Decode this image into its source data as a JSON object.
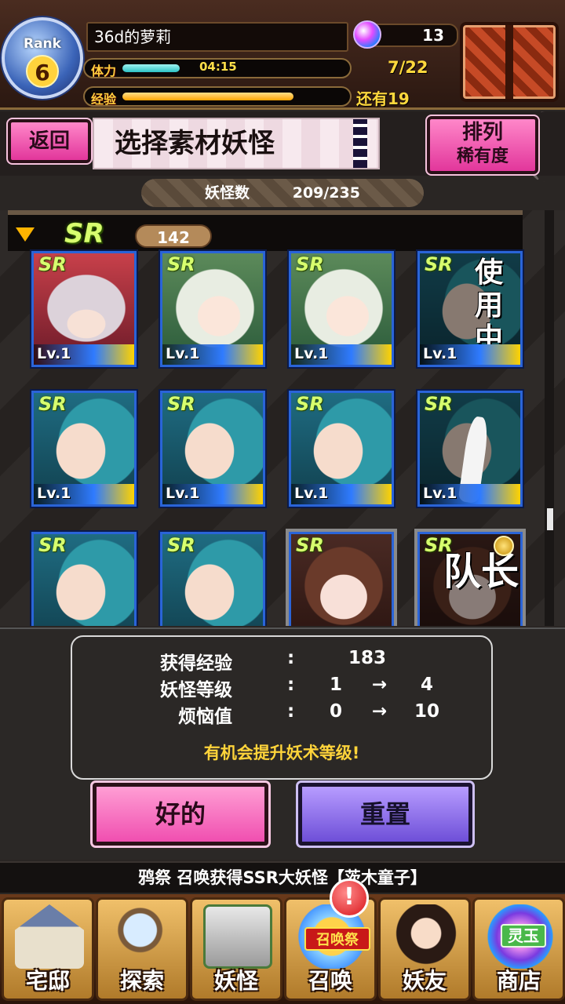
{
  "header": {
    "rank_label": "Rank",
    "rank_value": "6",
    "player_name": "36d的萝莉",
    "stamina_label": "体力",
    "stamina_timer": "04:15",
    "stamina_fill": 0.26,
    "stamina_count": "7/22",
    "exp_label": "经验",
    "exp_fill": 0.78,
    "exp_remaining": "还有19",
    "gems": "13"
  },
  "title_bar": {
    "back_label": "返回",
    "title": "选择素材妖怪",
    "sort_line1": "排列",
    "sort_line2": "稀有度"
  },
  "count": {
    "label": "妖怪数",
    "value": "209/235"
  },
  "group": {
    "rarity": "SR",
    "count": "142"
  },
  "cards": [
    {
      "badge": "SR",
      "level": "Lv.1",
      "art": "girl-red",
      "overlay": ""
    },
    {
      "badge": "SR",
      "level": "Lv.1",
      "art": "girl-white",
      "overlay": ""
    },
    {
      "badge": "SR",
      "level": "Lv.1",
      "art": "girl-white",
      "overlay": ""
    },
    {
      "badge": "SR",
      "level": "Lv.1",
      "art": "girl-blue",
      "overlay": "使用中"
    },
    {
      "badge": "SR",
      "level": "Lv.1",
      "art": "girl-blue",
      "overlay": ""
    },
    {
      "badge": "SR",
      "level": "Lv.1",
      "art": "girl-blue",
      "overlay": ""
    },
    {
      "badge": "SR",
      "level": "Lv.1",
      "art": "girl-blue",
      "overlay": ""
    },
    {
      "badge": "SR",
      "level": "Lv.1",
      "art": "girl-blue",
      "overlay": ""
    },
    {
      "badge": "SR",
      "level": "",
      "art": "girl-blue",
      "overlay": ""
    },
    {
      "badge": "SR",
      "level": "",
      "art": "girl-blue",
      "overlay": ""
    },
    {
      "badge": "SR",
      "level": "",
      "art": "girl-brown",
      "overlay": ""
    },
    {
      "badge": "SR",
      "level": "",
      "art": "girl-brown",
      "overlay": "队长"
    }
  ],
  "result": {
    "exp_key": "获得经验",
    "exp_value": "183",
    "level_key": "妖怪等级",
    "level_from": "1",
    "level_to": "4",
    "worry_key": "烦恼值",
    "worry_from": "0",
    "worry_to": "10",
    "colon": ":",
    "arrow": "→",
    "hint": "有机会提升妖术等级!",
    "ok_label": "好的",
    "reset_label": "重置"
  },
  "ticker": "鸦祭 召唤获得SSR大妖怪【茨木童子】",
  "nav": {
    "items": [
      {
        "label": "宅邸",
        "icon": "house-icon"
      },
      {
        "label": "探索",
        "icon": "magnifier-map-icon"
      },
      {
        "label": "妖怪",
        "icon": "scroll-monster-icon"
      },
      {
        "label": "召唤",
        "icon": "summon-star-icon"
      },
      {
        "label": "妖友",
        "icon": "friend-catgirl-icon"
      },
      {
        "label": "商店",
        "icon": "spirit-orb-icon"
      }
    ],
    "notice": "!",
    "summon_badge": "召唤祭",
    "shop_tag": "灵玉"
  },
  "colors": {
    "accent_pink": "#e2369b",
    "accent_purple": "#6e4fd8",
    "hint_yellow": "#ffd43a",
    "sr_green": "#d7ff6e"
  }
}
